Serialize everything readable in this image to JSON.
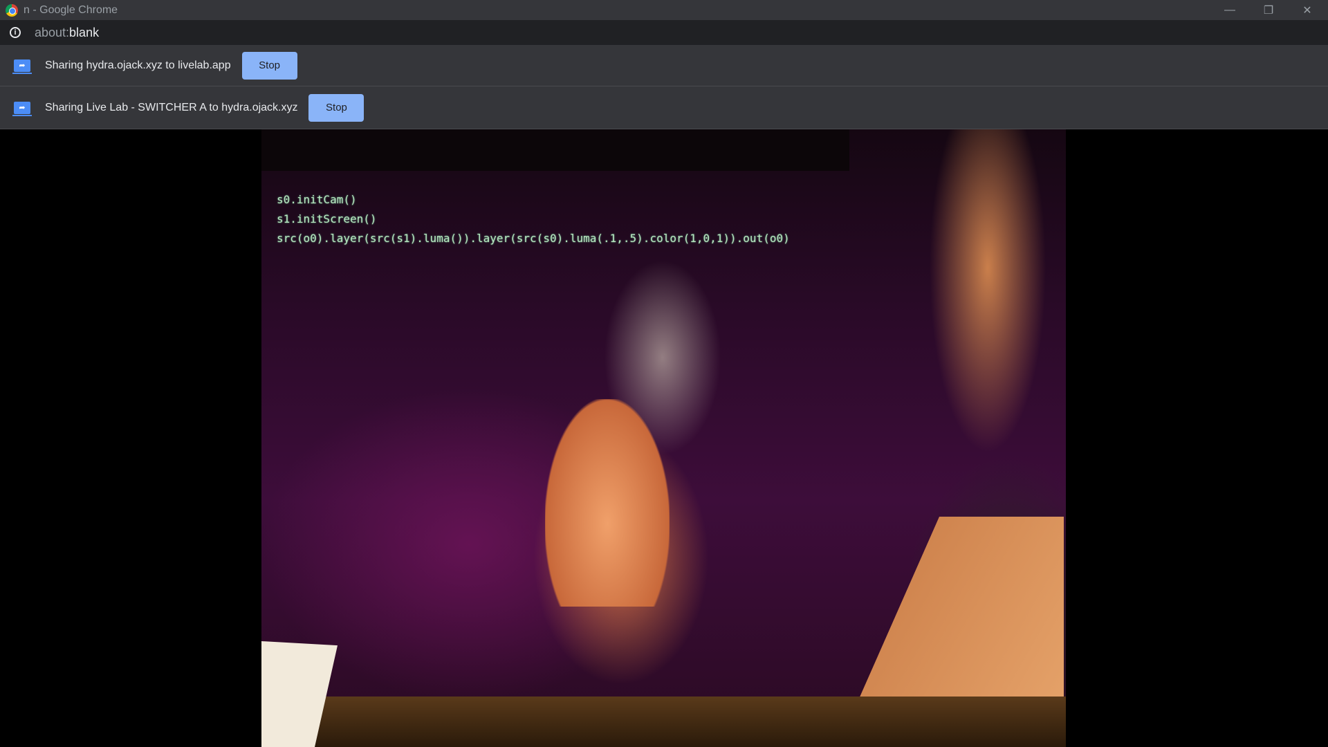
{
  "window": {
    "title": "n - Google Chrome",
    "controls": [
      "minimize",
      "restore",
      "close"
    ]
  },
  "address_bar": {
    "scheme": "about:",
    "path": "blank"
  },
  "infobars": [
    {
      "message": "Sharing hydra.ojack.xyz to livelab.app",
      "button": "Stop"
    },
    {
      "message": "Sharing Live Lab - SWITCHER A to hydra.ojack.xyz",
      "button": "Stop"
    }
  ],
  "video": {
    "code_lines": [
      "s0.initCam()",
      "s1.initScreen()",
      "src(o0).layer(src(s1).luma()).layer(src(s0).luma(.1,.5).color(1,0,1)).out(o0)"
    ]
  },
  "colors": {
    "accent": "#8ab4f8",
    "share_icon": "#4c8df6"
  }
}
